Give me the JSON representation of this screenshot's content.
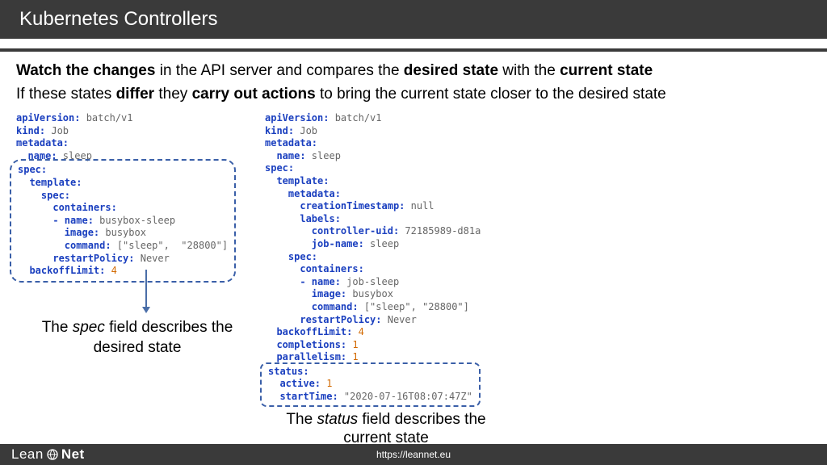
{
  "header": {
    "title": "Kubernetes Controllers"
  },
  "intro": {
    "line1_parts": [
      "Watch the changes",
      " in the API server and compares the ",
      "desired state",
      " with the ",
      "current state"
    ],
    "line2_parts": [
      "If these states ",
      "differ",
      " they ",
      "carry out actions",
      " to bring the current state closer to the desired state"
    ]
  },
  "code_left": {
    "pre": [
      {
        "k": "apiVersion:",
        "v": " batch/v1"
      },
      {
        "k": "kind:",
        "v": " Job"
      },
      {
        "k": "metadata:",
        "v": ""
      },
      {
        "k": "  name:",
        "v": " sleep"
      }
    ],
    "spec": [
      {
        "k": "spec:",
        "v": ""
      },
      {
        "k": "  template:",
        "v": ""
      },
      {
        "k": "    spec:",
        "v": ""
      },
      {
        "k": "      containers:",
        "v": ""
      },
      {
        "k": "      - name:",
        "v": " busybox-sleep"
      },
      {
        "k": "        image:",
        "v": " busybox"
      },
      {
        "k": "        command:",
        "v": " [\"sleep\",  \"28800\"]"
      },
      {
        "k": "      restartPolicy:",
        "v": " Never"
      },
      {
        "k": "  backoffLimit:",
        "n": " 4"
      }
    ]
  },
  "code_right": {
    "body": [
      {
        "k": "apiVersion:",
        "v": " batch/v1"
      },
      {
        "k": "kind:",
        "v": " Job"
      },
      {
        "k": "metadata:",
        "v": ""
      },
      {
        "k": "  name:",
        "v": " sleep"
      },
      {
        "k": "spec:",
        "v": ""
      },
      {
        "k": "  template:",
        "v": ""
      },
      {
        "k": "    metadata:",
        "v": ""
      },
      {
        "k": "      creationTimestamp:",
        "v": " null"
      },
      {
        "k": "      labels:",
        "v": ""
      },
      {
        "k": "        controller-uid:",
        "v": " 72185989-d81a"
      },
      {
        "k": "        job-name:",
        "v": " sleep"
      },
      {
        "k": "    spec:",
        "v": ""
      },
      {
        "k": "      containers:",
        "v": ""
      },
      {
        "k": "      - name:",
        "v": " job-sleep"
      },
      {
        "k": "        image:",
        "v": " busybox"
      },
      {
        "k": "        command:",
        "v": " [\"sleep\", \"28800\"]"
      },
      {
        "k": "      restartPolicy:",
        "v": " Never"
      },
      {
        "k": "  backoffLimit:",
        "n": " 4"
      },
      {
        "k": "  completions:",
        "n": " 1"
      },
      {
        "k": "  parallelism:",
        "n": " 1"
      }
    ],
    "status": [
      {
        "k": "status:",
        "v": ""
      },
      {
        "k": "  active:",
        "n": " 1"
      },
      {
        "k": "  startTime:",
        "v": " \"2020-07-16T08:07:47Z\""
      }
    ]
  },
  "captions": {
    "left_pre": "The ",
    "left_em": "spec",
    "left_post": " field describes the desired state",
    "right_pre": "The ",
    "right_em": "status",
    "right_post": " field describes the current state"
  },
  "footer": {
    "brand1": "Lean",
    "brand2": "Net",
    "url": "https://leannet.eu"
  }
}
